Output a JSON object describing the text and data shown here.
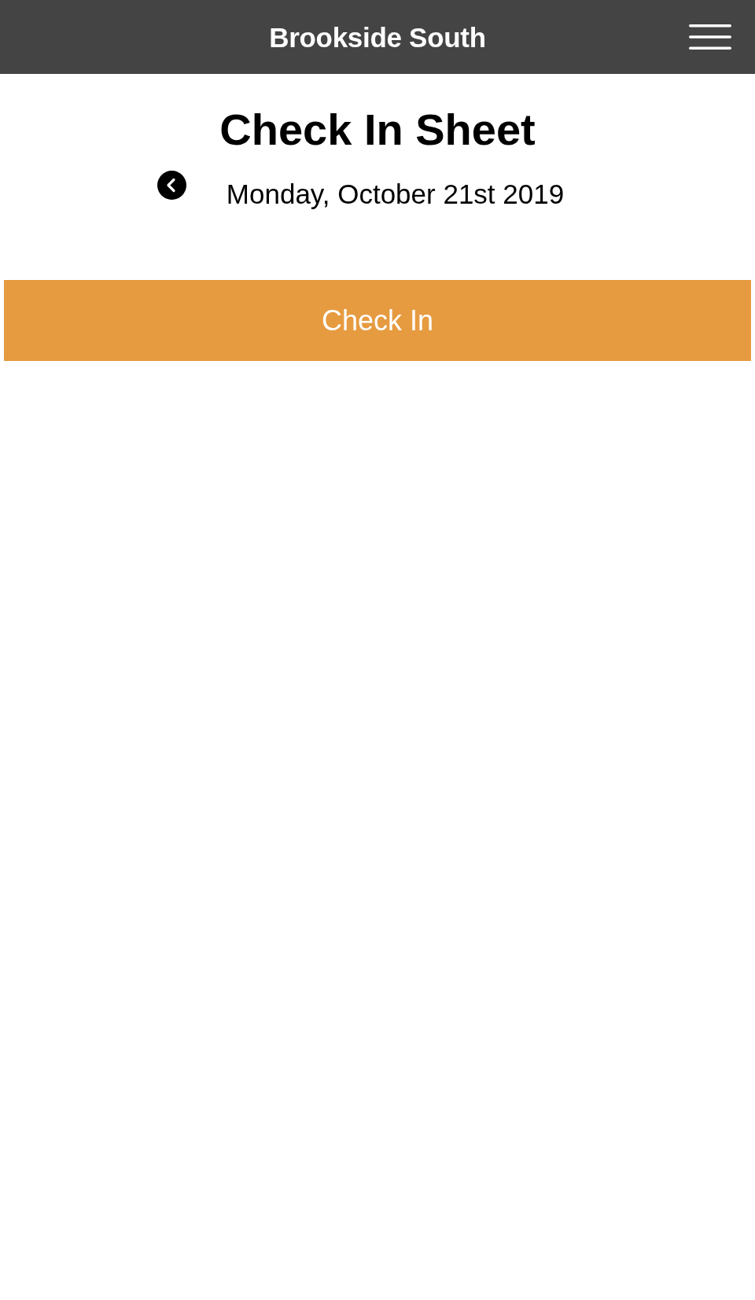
{
  "header": {
    "title": "Brookside South"
  },
  "sheet": {
    "title": "Check In Sheet",
    "date": "Monday, October 21st 2019"
  },
  "check_in_button": {
    "label": "Check In"
  }
}
